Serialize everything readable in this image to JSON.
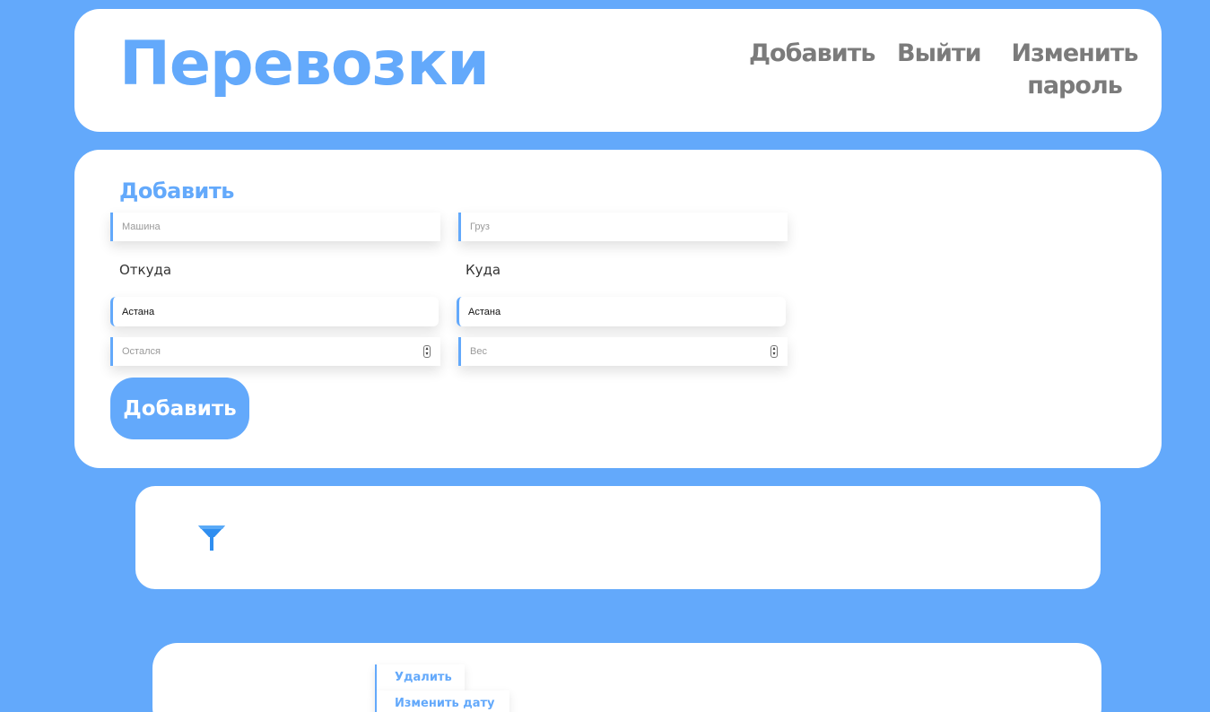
{
  "header": {
    "title": "Перевозки",
    "nav": {
      "add": "Добавить",
      "logout": "Выйти",
      "change_password": "Изменить пароль"
    }
  },
  "add_form": {
    "title": "Добавить",
    "car_placeholder": "Машина",
    "cargo_placeholder": "Груз",
    "from_label": "Откуда",
    "to_label": "Куда",
    "from_value": "Астана",
    "to_value": "Астана",
    "left_placeholder": "Остался",
    "weight_placeholder": "Вес",
    "submit_label": "Добавить"
  },
  "filter": {
    "icon": "filter-icon"
  },
  "record_menu": {
    "delete_label": "Удалить",
    "change_date_label": "Изменить дату"
  },
  "colors": {
    "accent": "#63a9fb",
    "nav_text": "#7b7b7b",
    "background": "#63a9fb"
  }
}
